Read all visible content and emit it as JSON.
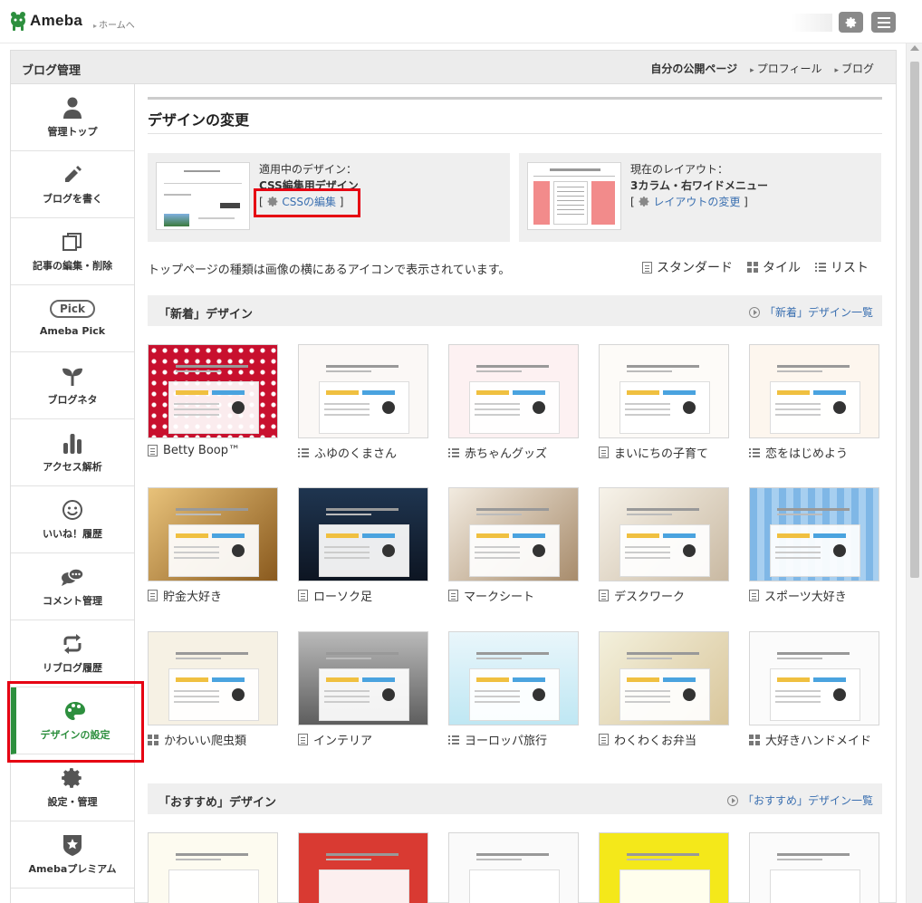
{
  "topbar": {
    "logo_text": "Ameba",
    "home_link": "ホームへ"
  },
  "frame": {
    "title": "ブログ管理",
    "header_links": [
      "自分の公開ページ",
      "プロフィール",
      "ブログ"
    ]
  },
  "sidebar": {
    "items": [
      {
        "label": "管理トップ",
        "icon": "person-icon"
      },
      {
        "label": "ブログを書く",
        "icon": "pencil-icon"
      },
      {
        "label": "記事の編集・削除",
        "icon": "copy-icon"
      },
      {
        "label": "Ameba Pick",
        "icon": "pick-badge-icon",
        "badge": "Pick"
      },
      {
        "label": "ブログネタ",
        "icon": "sprout-icon"
      },
      {
        "label": "アクセス解析",
        "icon": "bar-chart-icon"
      },
      {
        "label": "いいね！履歴",
        "icon": "smile-icon"
      },
      {
        "label": "コメント管理",
        "icon": "comment-icon"
      },
      {
        "label": "リブログ履歴",
        "icon": "reblog-icon"
      },
      {
        "label": "デザインの設定",
        "icon": "palette-icon",
        "active": true
      },
      {
        "label": "設定・管理",
        "icon": "gear-icon"
      },
      {
        "label": "Amebaプレミアム",
        "icon": "star-shield-icon"
      }
    ]
  },
  "main": {
    "page_title": "デザインの変更",
    "current_design": {
      "label": "適用中のデザイン：",
      "name": "CSS編集用デザイン",
      "edit_link": "CSSの編集"
    },
    "current_layout": {
      "label": "現在のレイアウト：",
      "name": "3カラム・右ワイドメニュー",
      "change_link": "レイアウトの変更"
    },
    "caption": "トップページの種類は画像の横にあるアイコンで表示されています。",
    "view_modes": [
      "スタンダード",
      "タイル",
      "リスト"
    ],
    "sections": [
      {
        "title": "「新着」デザイン",
        "more_link": "「新着」デザイン一覧",
        "tiles": [
          {
            "name": "Betty Boop™",
            "type": "doc"
          },
          {
            "name": "ふゆのくまさん",
            "type": "list"
          },
          {
            "name": "赤ちゃんグッズ",
            "type": "list"
          },
          {
            "name": "まいにちの子育て",
            "type": "doc"
          },
          {
            "name": "恋をはじめよう",
            "type": "list"
          },
          {
            "name": "貯金大好き",
            "type": "doc"
          },
          {
            "name": "ローソク足",
            "type": "doc"
          },
          {
            "name": "マークシート",
            "type": "doc"
          },
          {
            "name": "デスクワーク",
            "type": "doc"
          },
          {
            "name": "スポーツ大好き",
            "type": "doc"
          },
          {
            "name": "かわいい爬虫類",
            "type": "tile"
          },
          {
            "name": "インテリア",
            "type": "doc"
          },
          {
            "name": "ヨーロッパ旅行",
            "type": "list"
          },
          {
            "name": "わくわくお弁当",
            "type": "doc"
          },
          {
            "name": "大好きハンドメイド",
            "type": "tile"
          }
        ]
      },
      {
        "title": "「おすすめ」デザイン",
        "more_link": "「おすすめ」デザイン一覧"
      }
    ]
  },
  "colors": {
    "accent_green": "#2d8f3e",
    "highlight_red": "#e60012",
    "link_blue": "#3a6fb0"
  }
}
